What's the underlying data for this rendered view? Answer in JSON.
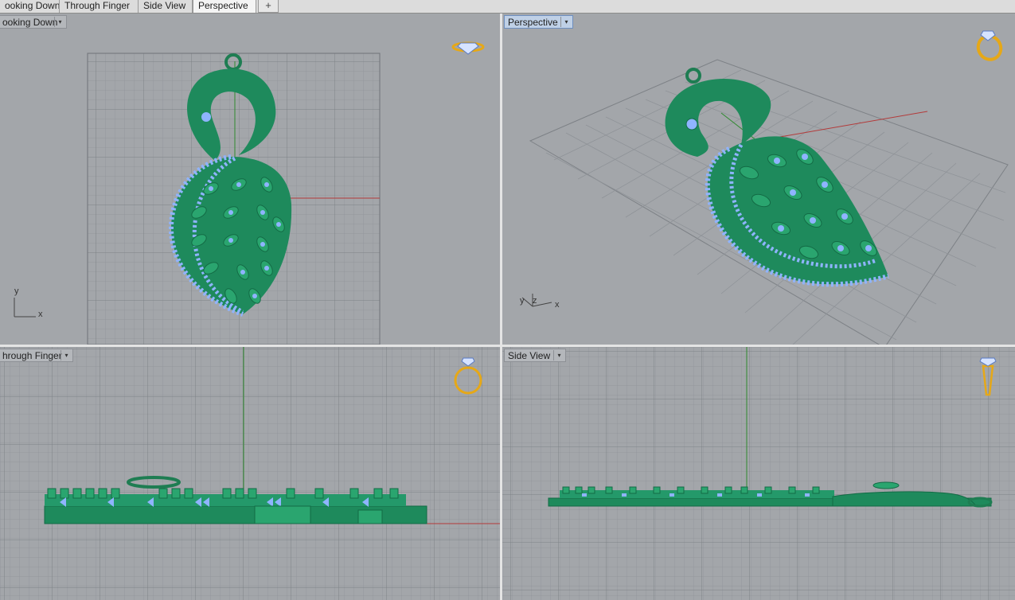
{
  "tabs": [
    {
      "label": "ooking Down"
    },
    {
      "label": "Through Finger"
    },
    {
      "label": "Side View"
    },
    {
      "label": "Perspective"
    }
  ],
  "new_tab_symbol": "+",
  "viewports": {
    "top_left": {
      "label": "ooking Down",
      "axis_x": "x",
      "axis_y": "y",
      "icon": "diamond-icon"
    },
    "top_right": {
      "label": "Perspective",
      "axis_x": "x",
      "axis_y": "y",
      "axis_z": "z",
      "icon": "ring-icon"
    },
    "bottom_left": {
      "label": "hrough Finger",
      "icon": "ring-front-icon"
    },
    "bottom_right": {
      "label": "Side View",
      "icon": "ring-side-icon"
    }
  },
  "dropdown_glyph": "▾",
  "colors": {
    "viewport_bg": "#a3a6aa",
    "model_green": "#1e8a5c",
    "gem_blue": "#8fb4ff",
    "x_axis": "#b33a3a",
    "y_axis": "#2f8a2f",
    "icon_gold": "#e6a817"
  }
}
